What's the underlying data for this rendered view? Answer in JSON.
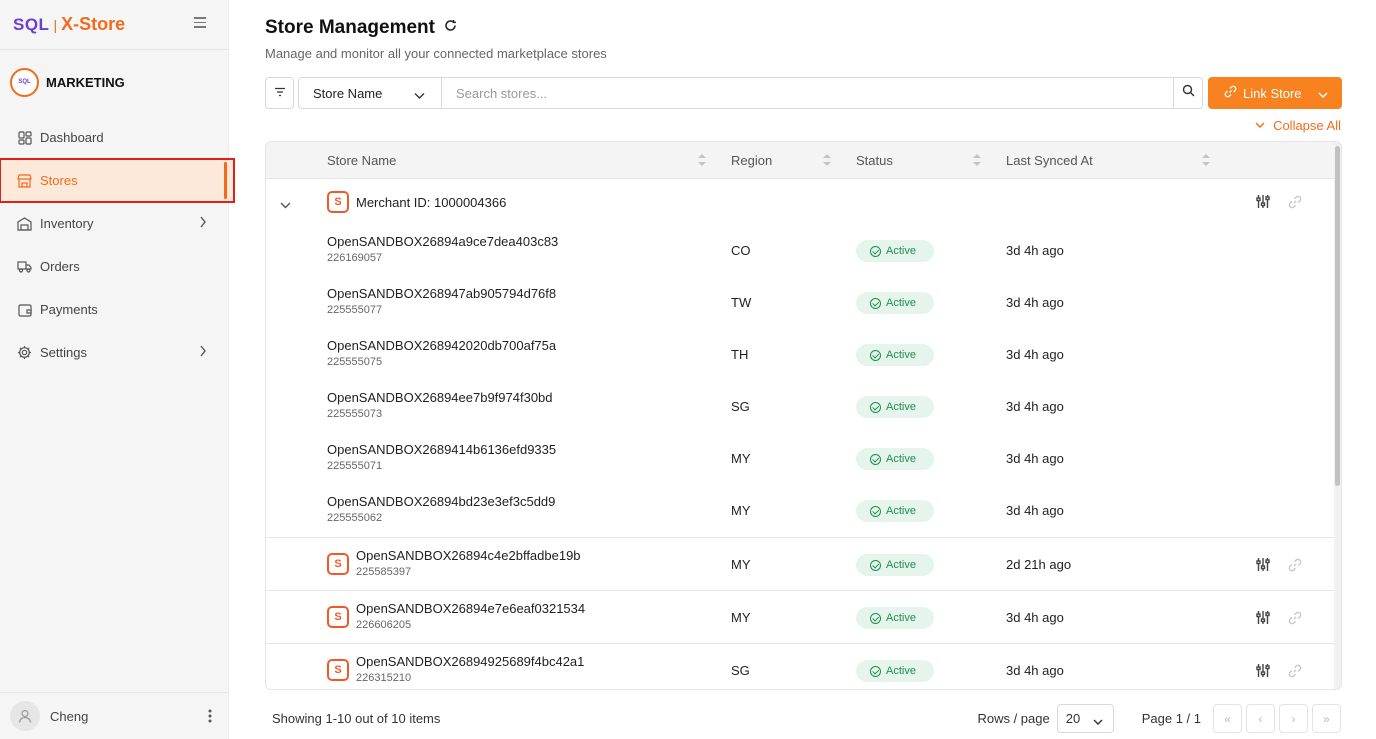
{
  "brand": {
    "sql": "SQL",
    "sep": "|",
    "xstore": "X-Store"
  },
  "org": {
    "name": "MARKETING",
    "logo_text": "SQL"
  },
  "sidebar": {
    "items": [
      {
        "label": "Dashboard"
      },
      {
        "label": "Stores"
      },
      {
        "label": "Inventory"
      },
      {
        "label": "Orders"
      },
      {
        "label": "Payments"
      },
      {
        "label": "Settings"
      }
    ]
  },
  "user": {
    "name": "Cheng"
  },
  "page": {
    "title": "Store Management",
    "subtitle": "Manage and monitor all your connected marketplace stores"
  },
  "toolbar": {
    "filter_field": "Store Name",
    "search_placeholder": "Search stores...",
    "link_store_label": "Link Store",
    "collapse_label": "Collapse All"
  },
  "table": {
    "columns": [
      "Store Name",
      "Region",
      "Status",
      "Last Synced At"
    ],
    "group": {
      "label": "Merchant ID: 1000004366"
    },
    "group_rows": [
      {
        "name": "OpenSANDBOX26894a9ce7dea403c83",
        "id": "226169057",
        "region": "CO",
        "status": "Active",
        "synced": "3d 4h ago"
      },
      {
        "name": "OpenSANDBOX268947ab905794d76f8",
        "id": "225555077",
        "region": "TW",
        "status": "Active",
        "synced": "3d 4h ago"
      },
      {
        "name": "OpenSANDBOX268942020db700af75a",
        "id": "225555075",
        "region": "TH",
        "status": "Active",
        "synced": "3d 4h ago"
      },
      {
        "name": "OpenSANDBOX26894ee7b9f974f30bd",
        "id": "225555073",
        "region": "SG",
        "status": "Active",
        "synced": "3d 4h ago"
      },
      {
        "name": "OpenSANDBOX2689414b6136efd9335",
        "id": "225555071",
        "region": "MY",
        "status": "Active",
        "synced": "3d 4h ago"
      },
      {
        "name": "OpenSANDBOX26894bd23e3ef3c5dd9",
        "id": "225555062",
        "region": "MY",
        "status": "Active",
        "synced": "3d 4h ago"
      }
    ],
    "standalone_rows": [
      {
        "name": "OpenSANDBOX26894c4e2bffadbe19b",
        "id": "225585397",
        "region": "MY",
        "status": "Active",
        "synced": "2d 21h ago"
      },
      {
        "name": "OpenSANDBOX26894e7e6eaf0321534",
        "id": "226606205",
        "region": "MY",
        "status": "Active",
        "synced": "3d 4h ago"
      },
      {
        "name": "OpenSANDBOX26894925689f4bc42a1",
        "id": "226315210",
        "region": "SG",
        "status": "Active",
        "synced": "3d 4h ago"
      }
    ],
    "shop_icon_glyph": "S"
  },
  "footer": {
    "showing": "Showing 1-10 out of 10 items",
    "rows_label": "Rows / page",
    "rows_value": "20",
    "page_info": "Page 1 / 1"
  },
  "colors": {
    "accent": "#f7821f",
    "brand_purple": "#6b3fd4",
    "active_bg": "#e6f5ec",
    "active_text": "#1e8e4e",
    "highlight_border": "#e0201b"
  }
}
